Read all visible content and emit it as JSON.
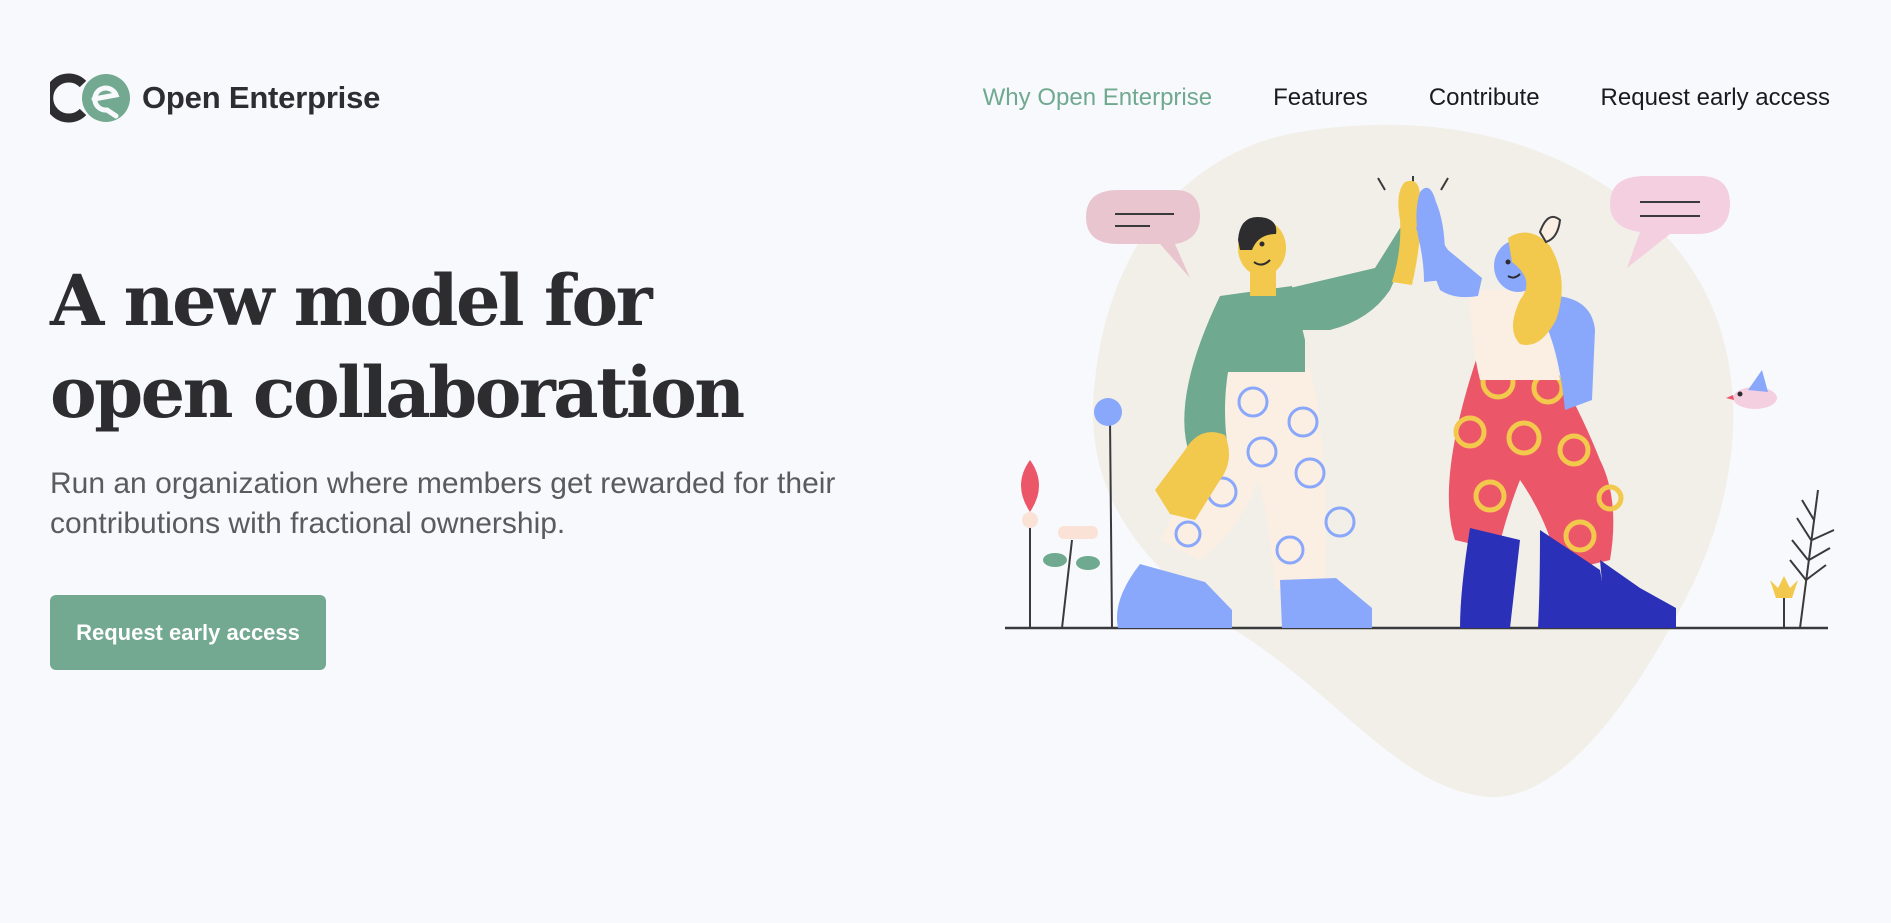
{
  "brand": {
    "name": "Open Enterprise",
    "mark_icon": "open-enterprise-logo-icon",
    "colors": {
      "dark": "#2e2e30",
      "accent": "#72a990"
    }
  },
  "nav": {
    "items": [
      {
        "label": "Why Open Enterprise",
        "active": true
      },
      {
        "label": "Features",
        "active": false
      },
      {
        "label": "Contribute",
        "active": false
      },
      {
        "label": "Request early access",
        "active": false
      }
    ]
  },
  "hero": {
    "title_line1": "A new model for",
    "title_line2": "open collaboration",
    "subtitle": "Run an organization where members get rewarded for their contributions with fractional ownership.",
    "cta_label": "Request early access"
  },
  "illustration": {
    "icon": "high-five-illustration",
    "colors": {
      "blob": "#f2efe8",
      "green": "#6fa98f",
      "yellow": "#f2c94c",
      "blue": "#8aa8fb",
      "navy": "#2b30b8",
      "red": "#ec5669",
      "cream": "#fbeee2",
      "pink": "#eec6d1"
    }
  }
}
